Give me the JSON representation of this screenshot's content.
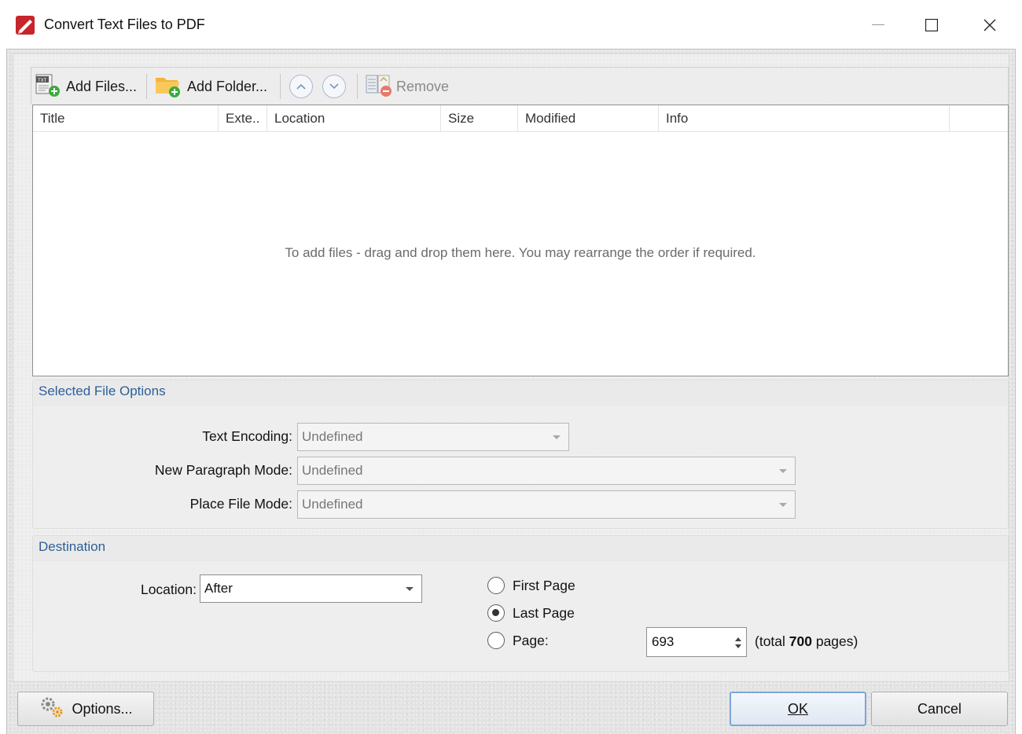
{
  "window": {
    "title": "Convert Text Files to PDF"
  },
  "toolbar": {
    "add_files": "Add Files...",
    "add_folder": "Add Folder...",
    "remove": "Remove"
  },
  "list": {
    "columns": [
      "Title",
      "Exte..",
      "Location",
      "Size",
      "Modified",
      "Info"
    ],
    "empty_hint": "To add files - drag and drop them here. You may rearrange the order if required."
  },
  "selected_file_options": {
    "title": "Selected File Options",
    "text_encoding_label": "Text Encoding:",
    "text_encoding_value": "Undefined",
    "new_paragraph_label": "New Paragraph Mode:",
    "new_paragraph_value": "Undefined",
    "place_file_label": "Place File Mode:",
    "place_file_value": "Undefined"
  },
  "destination": {
    "title": "Destination",
    "location_label": "Location:",
    "location_value": "After",
    "first_page": "First Page",
    "last_page": "Last Page",
    "page": "Page:",
    "page_value": "693",
    "total_prefix": "(total ",
    "total_pages": "700",
    "total_suffix": " pages)",
    "selected": "last_page"
  },
  "buttons": {
    "options": "Options...",
    "ok": "OK",
    "cancel": "Cancel"
  },
  "colors": {
    "group_title": "#2c5f98",
    "app_icon": "#c8242b"
  }
}
